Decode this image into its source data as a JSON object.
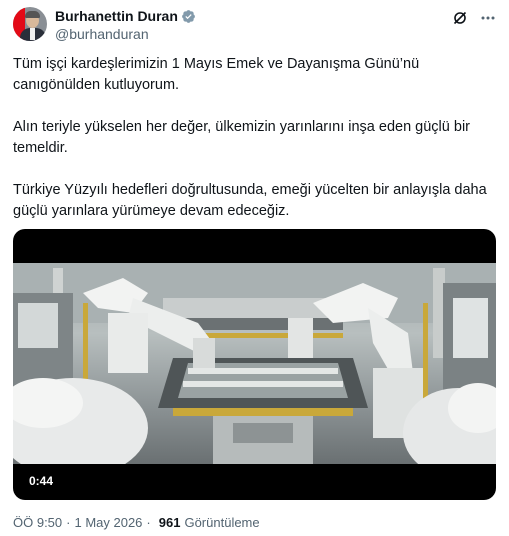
{
  "author": {
    "name": "Burhanettin Duran",
    "handle": "@burhanduran",
    "verified_color": "#829aab"
  },
  "tweet": {
    "paragraphs": [
      "Tüm işçi kardeşlerimizin 1 Mayıs Emek ve Dayanışma Günü’nü canıgönülden kutluyorum.",
      "Alın teriyle yükselen her değer, ülkemizin yarınlarını inşa eden güçlü bir temeldir.",
      "Türkiye Yüzyılı hedefleri doğrultusunda, emeği yücelten bir anlayışla daha güçlü yarınlara yürümeye devam edeceğiz."
    ]
  },
  "media": {
    "duration": "0:44"
  },
  "meta": {
    "time": "ÖÖ 9:50",
    "separator": "·",
    "date": "1 May 2026",
    "views": "961",
    "views_label": "Görüntüleme"
  },
  "icons": {
    "verified": "verified-badge-icon",
    "grok": "grok-icon",
    "more": "more-icon"
  }
}
